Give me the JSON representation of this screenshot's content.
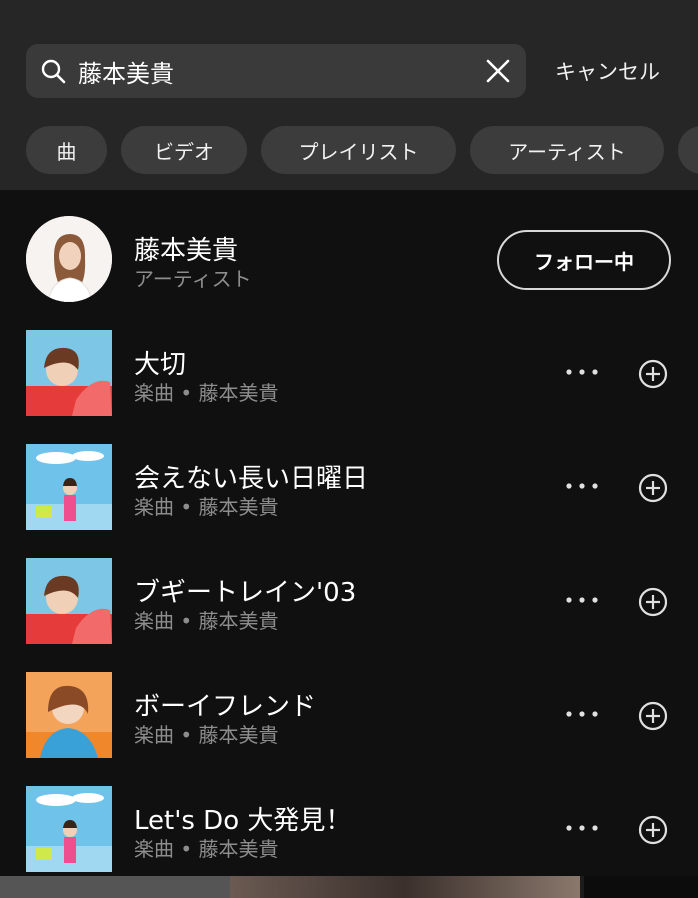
{
  "search": {
    "query": "藤本美貴",
    "cancel_label": "キャンセル"
  },
  "filters": [
    "曲",
    "ビデオ",
    "プレイリスト",
    "アーティスト",
    ""
  ],
  "artist": {
    "name": "藤本美貴",
    "type": "アーティスト",
    "follow_label": "フォロー中"
  },
  "tracks": [
    {
      "title": "大切",
      "subtitle": "楽曲 • 藤本美貴",
      "cover": "pink"
    },
    {
      "title": "会えない長い日曜日",
      "subtitle": "楽曲 • 藤本美貴",
      "cover": "sky"
    },
    {
      "title": "ブギートレイン'03",
      "subtitle": "楽曲 • 藤本美貴",
      "cover": "pink"
    },
    {
      "title": "ボーイフレンド",
      "subtitle": "楽曲 • 藤本美貴",
      "cover": "orange"
    },
    {
      "title": "Let's Do 大発見！",
      "subtitle": "楽曲 • 藤本美貴",
      "cover": "sky"
    }
  ],
  "colors": {
    "background": "#101010",
    "header": "#262626",
    "chip": "#3c3c3c",
    "secondary_text": "#8d8d8d"
  }
}
